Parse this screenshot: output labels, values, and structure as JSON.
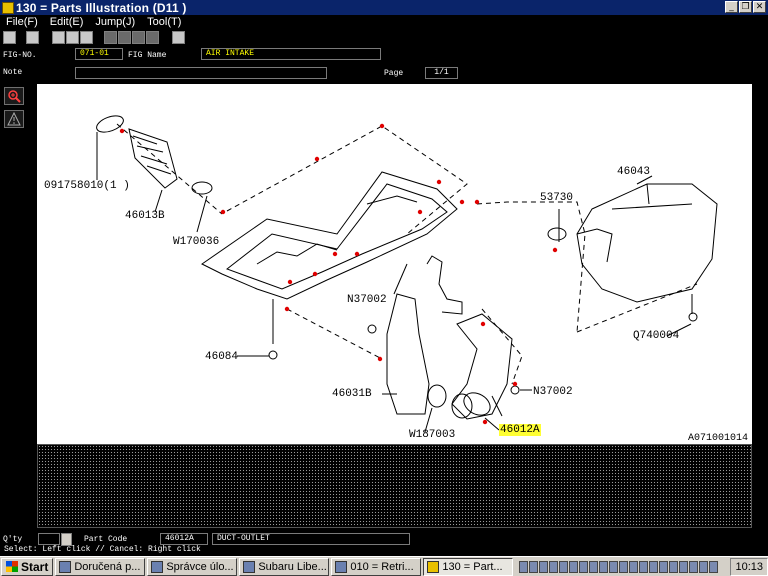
{
  "window": {
    "title": "130 = Parts Illustration (D11   )",
    "minimize": "_",
    "restore": "❐",
    "close": "✕"
  },
  "menu": [
    "File(F)",
    "Edit(E)",
    "Jump(J)",
    "Tool(T)"
  ],
  "header": {
    "fig_no_label": "FIG-NO.",
    "fig_no": "071-01",
    "fig_name_label": "FIG Name",
    "fig_name": "AIR INTAKE",
    "note_label": "Note",
    "note": "",
    "page_label": "Page",
    "page": "1/1"
  },
  "drawing": {
    "labels": {
      "p1": "091758010(1  )",
      "p2": "46013B",
      "p3": "W170036",
      "p4": "46084",
      "p5": "N37002",
      "p6": "46031B",
      "p7": "W187003",
      "p8": "46012A",
      "p9": "N37002",
      "p10": "53730",
      "p11": "46043",
      "p12": "Q740004"
    },
    "ref": "A071001014"
  },
  "part_row": {
    "qty_label": "Q'ty",
    "qty_value": "",
    "part_code_label": "Part Code",
    "part_code": "46012A",
    "part_name": "DUCT-OUTLET"
  },
  "status_text": "Select: Left click // Cancel: Right click",
  "taskbar": {
    "start": "Start",
    "tasks": [
      "Doručená p...",
      "Správce úlo...",
      "Subaru Libe...",
      "010 = Retri...",
      "130 = Part..."
    ],
    "clock": "10:13"
  },
  "colors": {
    "highlight": "#ffff33",
    "field_text": "#ffff00",
    "title_bar": "#0a246a"
  }
}
